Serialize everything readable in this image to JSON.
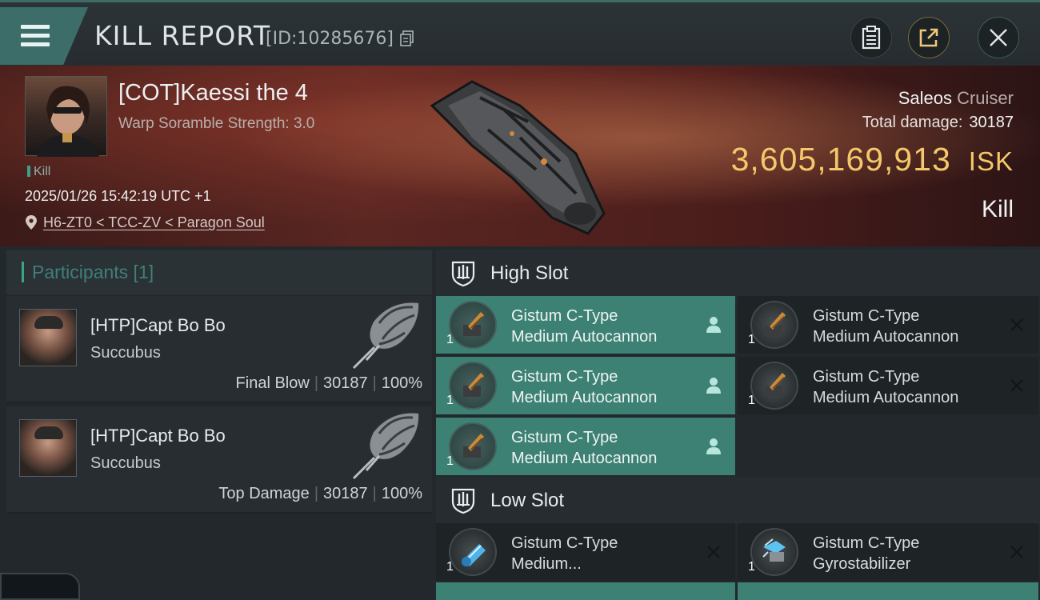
{
  "header": {
    "title": "KILL REPORT",
    "report_id": "[ID:10285676]"
  },
  "victim": {
    "name": "[COT]Kaessi the 4",
    "scramble": "Warp Soramble Strength: 3.0",
    "tag": "Kill",
    "datetime": "2025/01/26 15:42:19 UTC +1",
    "location": "H6-ZT0 < TCC-ZV < Paragon Soul",
    "ship": "Saleos",
    "ship_class": "Cruiser",
    "total_damage_label": "Total damage:",
    "total_damage": "30187",
    "isk_value": "3,605,169,913",
    "isk_unit": "ISK",
    "result": "Kill"
  },
  "participants": {
    "header": "Participants [1]",
    "items": [
      {
        "name": "[HTP]Capt Bo Bo",
        "ship": "Succubus",
        "role": "Final Blow",
        "damage": "30187",
        "percent": "100%"
      },
      {
        "name": "[HTP]Capt Bo Bo",
        "ship": "Succubus",
        "role": "Top Damage",
        "damage": "30187",
        "percent": "100%"
      }
    ]
  },
  "high_slot": {
    "title": "High Slot",
    "modules": [
      {
        "line1": "Gistum C-Type",
        "line2": "Medium Autocannon",
        "qty": "1",
        "status": "destroyed"
      },
      {
        "line1": "Gistum C-Type",
        "line2": "Medium Autocannon",
        "qty": "1",
        "status": "dropped"
      },
      {
        "line1": "Gistum C-Type",
        "line2": "Medium Autocannon",
        "qty": "1",
        "status": "destroyed"
      },
      {
        "line1": "Gistum C-Type",
        "line2": "Medium Autocannon",
        "qty": "1",
        "status": "dropped"
      },
      {
        "line1": "Gistum C-Type",
        "line2": "Medium Autocannon",
        "qty": "1",
        "status": "destroyed"
      }
    ]
  },
  "low_slot": {
    "title": "Low Slot",
    "modules": [
      {
        "line1": "Gistum C-Type",
        "line2": "Medium...",
        "qty": "1",
        "status": "dropped"
      },
      {
        "line1": "Gistum C-Type",
        "line2": "Gyrostabilizer",
        "qty": "1",
        "status": "dropped"
      }
    ]
  },
  "colors": {
    "accent_teal": "#3c8174",
    "isk_gold": "#f4c86a",
    "panel_bg": "#23282c"
  }
}
